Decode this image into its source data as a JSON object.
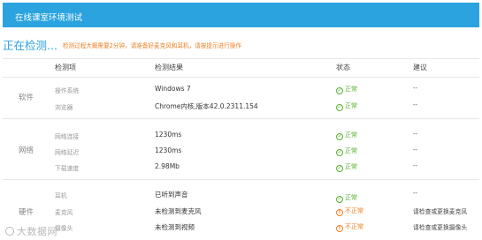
{
  "header": {
    "title": "在线课室环境测试"
  },
  "status": {
    "title": "正在检测...",
    "note": "检测过程大概需要2分钟，请准备好麦克风和耳机，请按提示进行操作"
  },
  "table": {
    "columns": [
      "检测项",
      "检测结果",
      "状态",
      "建议"
    ],
    "sections": [
      {
        "category": "软件",
        "rows": [
          {
            "item": "操作系统",
            "result": "Windows 7",
            "status": "正常",
            "status_type": "ok",
            "advice": "--"
          },
          {
            "item": "浏览器",
            "result": "Chrome内核,版本42.0.2311.154",
            "status": "正常",
            "status_type": "ok",
            "advice": "--"
          }
        ]
      },
      {
        "category": "网络",
        "rows": [
          {
            "item": "网络连接",
            "result": "1230ms",
            "status": "正常",
            "status_type": "ok",
            "advice": "--"
          },
          {
            "item": "网络延迟",
            "result": "1230ms",
            "status": "正常",
            "status_type": "ok",
            "advice": "--"
          },
          {
            "item": "下载速度",
            "result": "2.98Mb",
            "status": "正常",
            "status_type": "ok",
            "advice": "--"
          }
        ]
      },
      {
        "category": "硬件",
        "rows": [
          {
            "item": "耳机",
            "result": "已听到声音",
            "status": "正常",
            "status_type": "ok",
            "advice": "--"
          },
          {
            "item": "麦克风",
            "result": "未检测到麦克风",
            "status": "不正常",
            "status_type": "warn",
            "advice": "请检查或更换麦克风"
          },
          {
            "item": "摄像头",
            "result": "未检测到视频",
            "status": "不正常",
            "status_type": "warn",
            "advice": "请检查或更换摄像头"
          }
        ]
      }
    ]
  },
  "watermark": {
    "text": "大数据网"
  },
  "icons": {
    "ok": "check-circle-icon",
    "warn": "exclamation-circle-icon"
  },
  "colors": {
    "accent": "#2aa3df",
    "ok": "#5ab02f",
    "warn": "#ef7f22"
  }
}
